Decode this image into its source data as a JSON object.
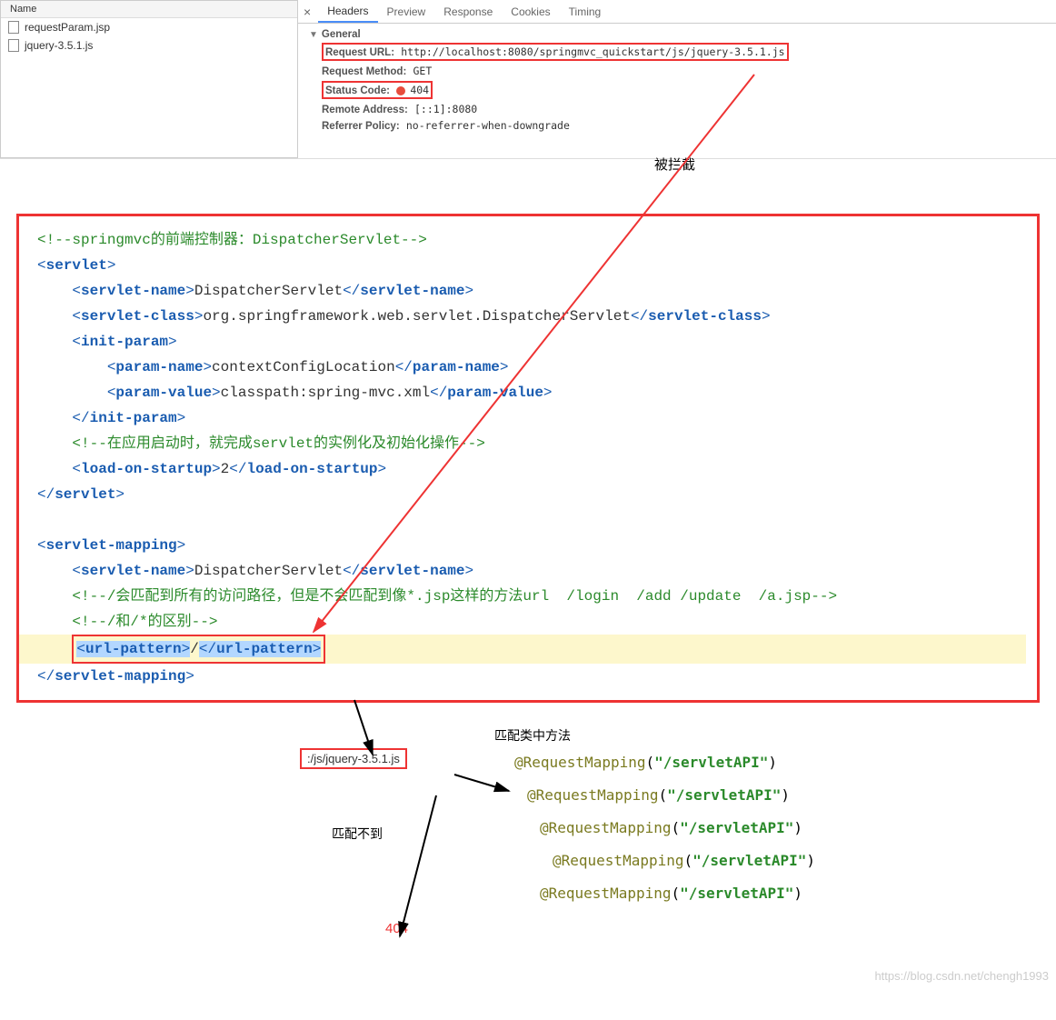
{
  "file_panel": {
    "header": "Name",
    "files": [
      "requestParam.jsp",
      "jquery-3.5.1.js"
    ]
  },
  "devtools": {
    "tabs": [
      "Headers",
      "Preview",
      "Response",
      "Cookies",
      "Timing"
    ],
    "general_label": "General",
    "request_url_label": "Request URL:",
    "request_url_value": "http://localhost:8080/springmvc_quickstart/js/jquery-3.5.1.js",
    "request_method_label": "Request Method:",
    "request_method_value": "GET",
    "status_code_label": "Status Code:",
    "status_code_value": "404",
    "remote_address_label": "Remote Address:",
    "remote_address_value": "[::1]:8080",
    "referrer_policy_label": "Referrer Policy:",
    "referrer_policy_value": "no-referrer-when-downgrade"
  },
  "annotations": {
    "blocked": "被拦截",
    "match_method": "匹配类中方法",
    "no_match": "匹配不到",
    "err404": "404",
    "url_snippet": ":/js/jquery-3.5.1.js"
  },
  "code": {
    "c1": "<!--springmvc的前端控制器：DispatcherServlet-->",
    "servlet_open": "servlet",
    "servlet_name_tag": "servlet-name",
    "servlet_name_val": "DispatcherServlet",
    "servlet_class_tag": "servlet-class",
    "servlet_class_val": "org.springframework.web.servlet.DispatcherServlet",
    "init_param_tag": "init-param",
    "param_name_tag": "param-name",
    "param_name_val": "contextConfigLocation",
    "param_value_tag": "param-value",
    "param_value_val": "classpath:spring-mvc.xml",
    "c2": "<!--在应用启动时，就完成servlet的实例化及初始化操作-->",
    "load_tag": "load-on-startup",
    "load_val": "2",
    "servlet_mapping_tag": "servlet-mapping",
    "c3": "<!--/会匹配到所有的访问路径，但是不会匹配到像*.jsp这样的方法url  /login  /add /update  /a.jsp-->",
    "c4": "<!--/和/*的区别-->",
    "url_pattern_tag": "url-pattern",
    "url_pattern_val": "/"
  },
  "mappings": {
    "anno": "@RequestMapping",
    "path": "\"/servletAPI\""
  },
  "watermark": "https://blog.csdn.net/chengh1993"
}
